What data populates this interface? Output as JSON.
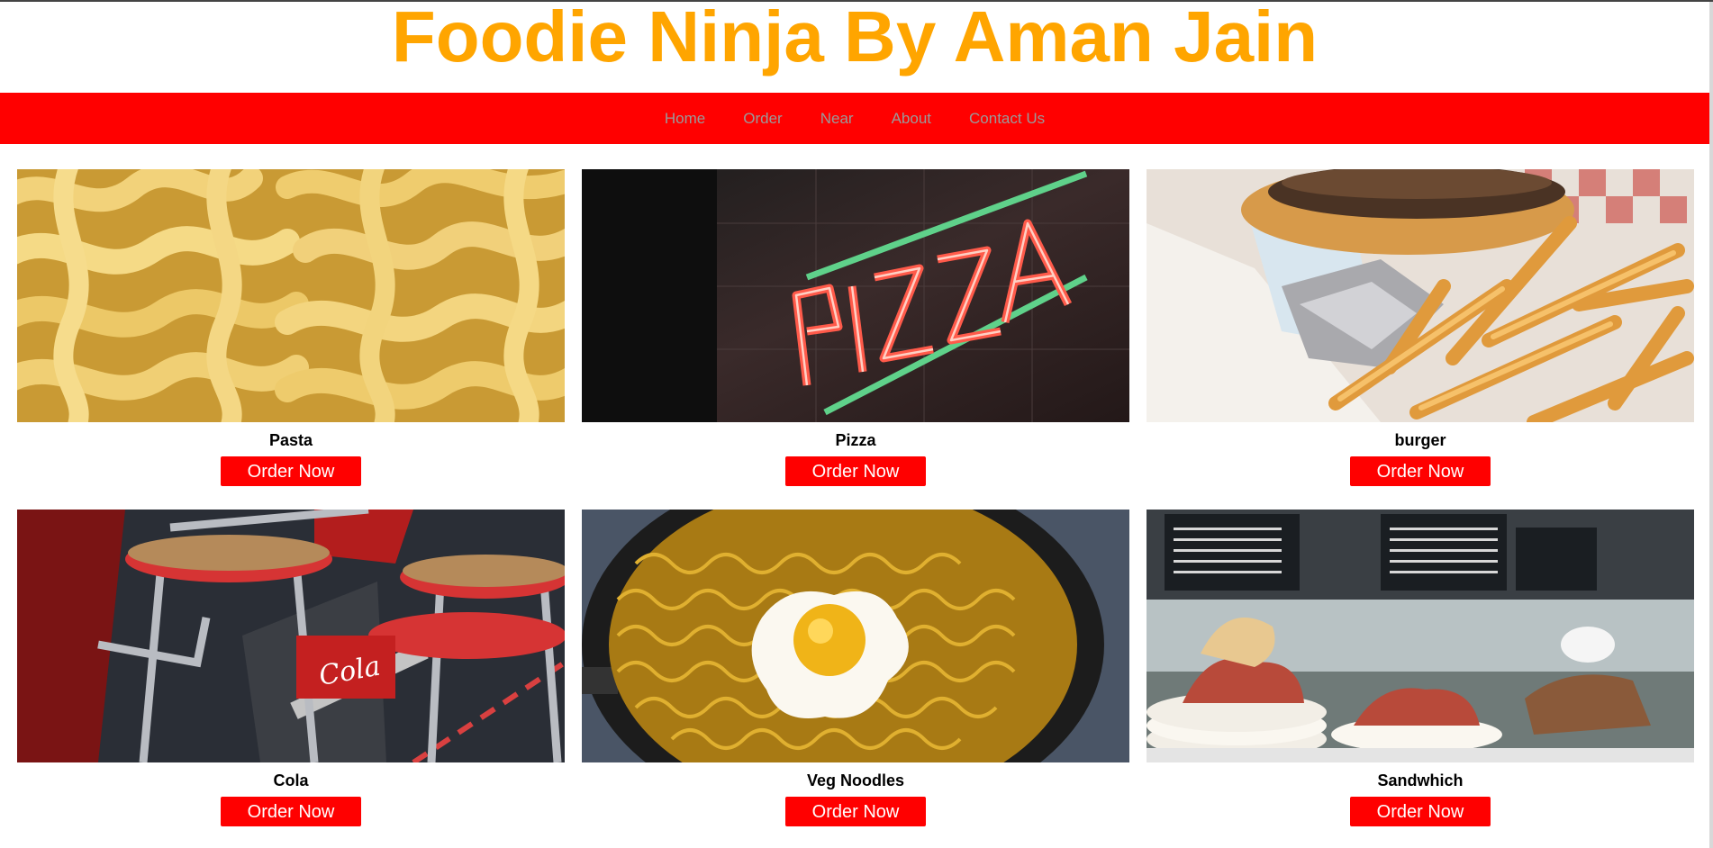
{
  "header": {
    "title": "Foodie Ninja By Aman Jain"
  },
  "nav": {
    "items": [
      "Home",
      "Order",
      "Near",
      "About",
      "Contact Us"
    ]
  },
  "colors": {
    "title": "#ffa500",
    "navbar": "#ff0000",
    "nav_link": "#9a9a9a",
    "button": "#ff0000"
  },
  "products": [
    {
      "name": "Pasta",
      "button": "Order Now",
      "image": "pasta-photo"
    },
    {
      "name": "Pizza",
      "button": "Order Now",
      "image": "pizza-neon-sign-photo"
    },
    {
      "name": "burger",
      "button": "Order Now",
      "image": "burger-fries-photo"
    },
    {
      "name": "Cola",
      "button": "Order Now",
      "image": "cola-chairs-photo"
    },
    {
      "name": "Veg Noodles",
      "button": "Order Now",
      "image": "noodles-egg-photo"
    },
    {
      "name": "Sandwhich",
      "button": "Order Now",
      "image": "sandwich-deli-photo"
    }
  ]
}
